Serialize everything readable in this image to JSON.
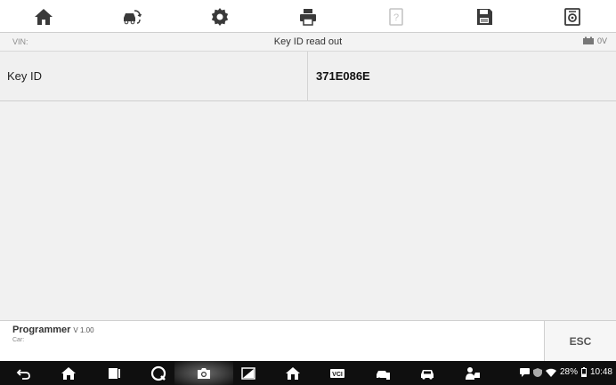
{
  "toolbar": {
    "buttons": [
      {
        "name": "home-icon"
      },
      {
        "name": "vehicle-swap-icon"
      },
      {
        "name": "settings-gear-icon"
      },
      {
        "name": "print-icon"
      },
      {
        "name": "help-icon"
      },
      {
        "name": "save-icon"
      },
      {
        "name": "data-record-icon"
      }
    ]
  },
  "infobar": {
    "vin_label": "VIN:",
    "title": "Key ID read out",
    "battery_voltage": "0V"
  },
  "row": {
    "label": "Key ID",
    "value": "371E086E"
  },
  "footer": {
    "program_name": "Programmer",
    "version": "V 1.00",
    "car_label": "Car:",
    "esc_label": "ESC"
  },
  "statusbar": {
    "battery_percent": "28%",
    "time": "10:48"
  },
  "colors": {
    "toolbar_icon": "#3a3a3a",
    "toolbar_icon_disabled": "#c4c4c4",
    "navbar_bg": "#0f0f0f",
    "panel_bg": "#f1f1f1"
  }
}
